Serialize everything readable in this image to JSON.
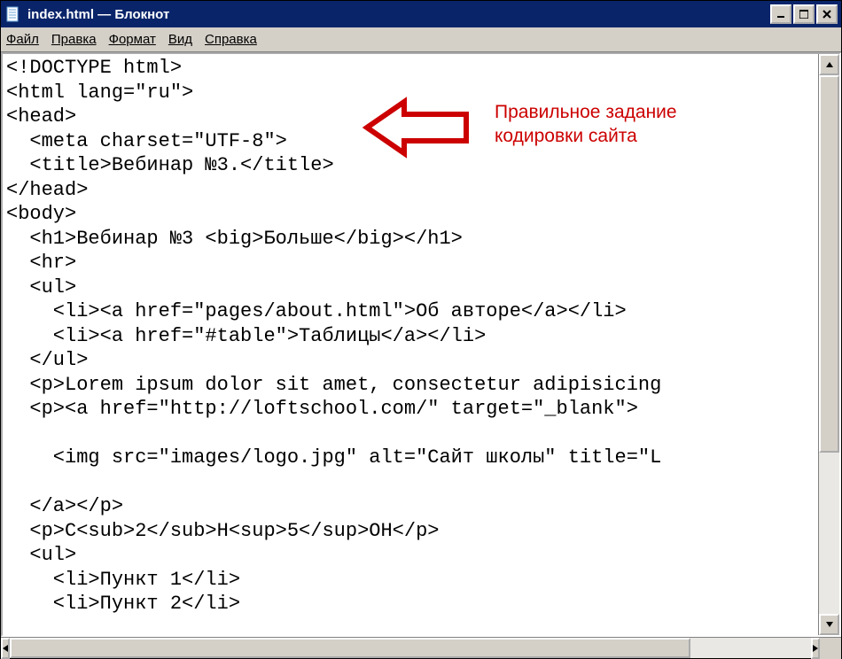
{
  "window": {
    "title": "index.html — Блокнот"
  },
  "menubar": {
    "file": "Файл",
    "edit": "Правка",
    "format": "Формат",
    "view": "Вид",
    "help": "Справка"
  },
  "editor": {
    "content": "<!DOCTYPE html>\n<html lang=\"ru\">\n<head>\n  <meta charset=\"UTF-8\">\n  <title>Вебинар №3.</title>\n</head>\n<body>\n  <h1>Вебинар №3 <big>Больше</big></h1>\n  <hr>\n  <ul>\n    <li><a href=\"pages/about.html\">Об авторе</a></li>\n    <li><a href=\"#table\">Таблицы</a></li>\n  </ul>\n  <p>Lorem ipsum dolor sit amet, consectetur adipisicing\n  <p><a href=\"http://loftschool.com/\" target=\"_blank\">\n\n    <img src=\"images/logo.jpg\" alt=\"Сайт школы\" title=\"L\n\n  </a></p>\n  <p>C<sub>2</sub>H<sup>5</sup>OH</p>\n  <ul>\n    <li>Пункт 1</li>\n    <li>Пункт 2</li>"
  },
  "annotation": {
    "line1": "Правильное задание",
    "line2": "кодировки сайта"
  }
}
